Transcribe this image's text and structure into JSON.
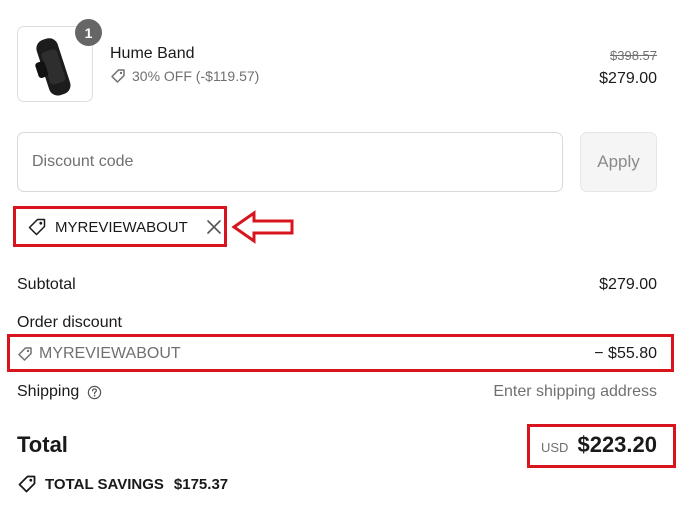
{
  "product": {
    "name": "Hume Band",
    "quantity": "1",
    "discount_text": "30% OFF (-$119.57)",
    "original_price": "$398.57",
    "price": "$279.00",
    "image_icon": "fitness-band-image"
  },
  "discount_input": {
    "placeholder": "Discount code",
    "value": "",
    "apply_label": "Apply"
  },
  "applied_code": {
    "code": "MYREVIEWABOUT",
    "tag_icon": "tag-icon",
    "remove_icon": "close-icon"
  },
  "summary": {
    "subtotal_label": "Subtotal",
    "subtotal_value": "$279.00",
    "order_discount_label": "Order discount",
    "order_discount_code": "MYREVIEWABOUT",
    "order_discount_value": "− $55.80",
    "shipping_label": "Shipping",
    "shipping_value": "Enter shipping address",
    "total_label": "Total",
    "currency": "USD",
    "total_value": "$223.20",
    "savings_label": "TOTAL SAVINGS",
    "savings_value": "$175.37"
  },
  "colors": {
    "highlight": "#d8141e",
    "muted_text": "#707070",
    "badge": "#666666"
  }
}
